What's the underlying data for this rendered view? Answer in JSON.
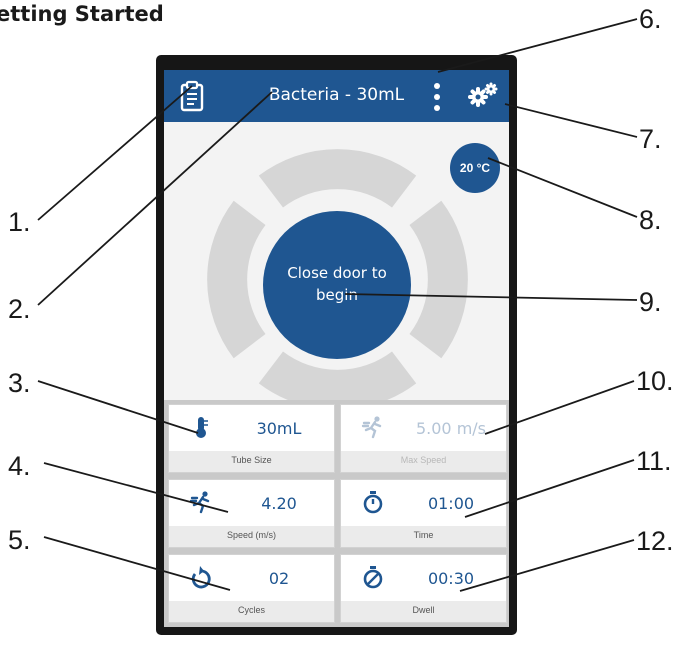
{
  "heading": "etting Started",
  "app": {
    "title": "Bacteria - 30mL",
    "temperature": "20 °C",
    "start_button": "Close door to begin"
  },
  "settings": [
    {
      "value": "30mL",
      "label": "Tube Size",
      "icon": "thermometer-tube-icon",
      "enabled": true
    },
    {
      "value": "5.00 m/s",
      "label": "Max Speed",
      "icon": "running-icon",
      "enabled": false
    },
    {
      "value": "4.20",
      "label": "Speed (m/s)",
      "icon": "running-icon",
      "enabled": true
    },
    {
      "value": "01:00",
      "label": "Time",
      "icon": "stopwatch-icon",
      "enabled": true
    },
    {
      "value": "02",
      "label": "Cycles",
      "icon": "repeat-icon",
      "enabled": true
    },
    {
      "value": "00:30",
      "label": "Dwell",
      "icon": "dwell-stopwatch-icon",
      "enabled": true
    }
  ],
  "callouts": [
    "1.",
    "2.",
    "3.",
    "4.",
    "5.",
    "6.",
    "7.",
    "8.",
    "9.",
    "10.",
    "11.",
    "12."
  ],
  "colors": {
    "primary": "#1f5691",
    "ring": "#d6d6d6",
    "bezel": "#161616"
  }
}
